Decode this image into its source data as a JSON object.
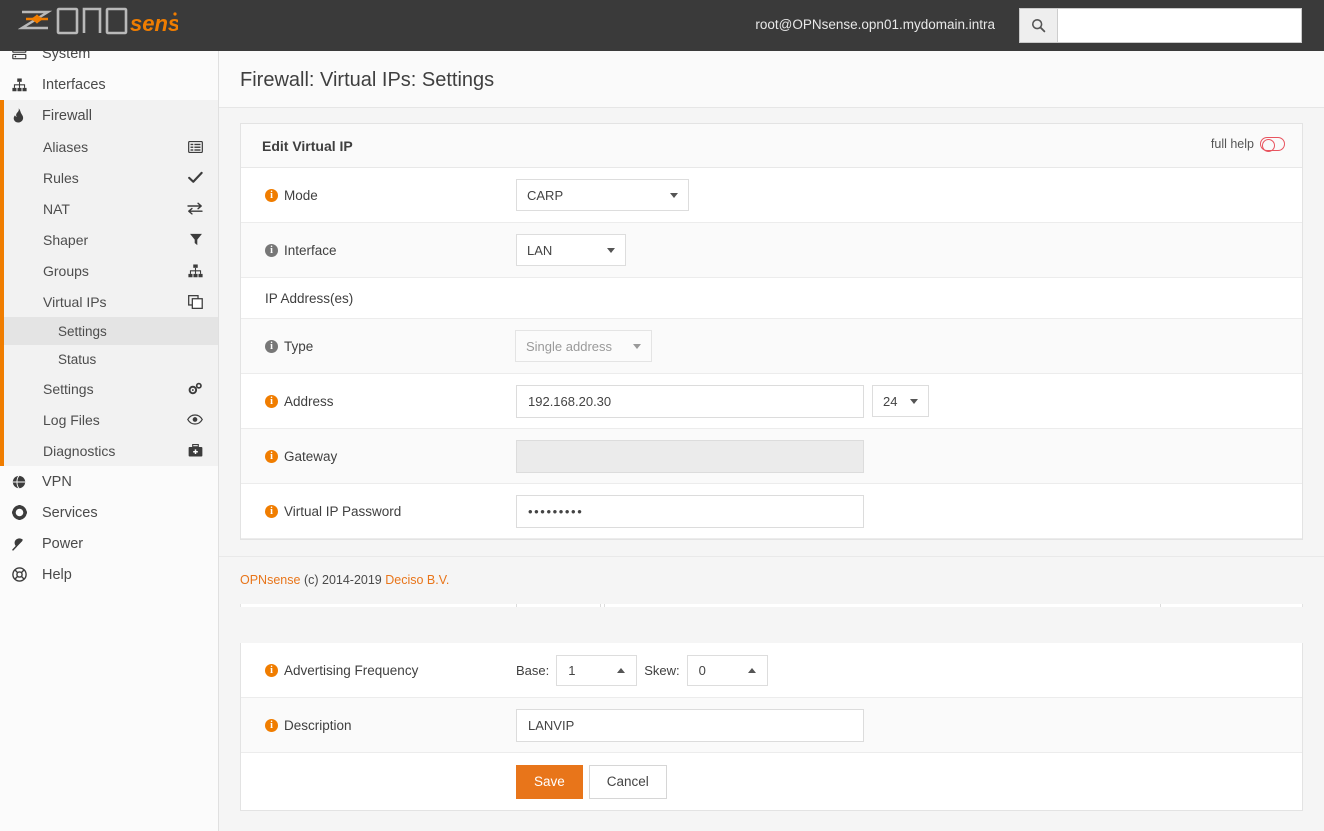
{
  "header": {
    "brand_opn": "OPN",
    "brand_sense": "sense",
    "user": "root@OPNsense.opn01.mydomain.intra",
    "search_placeholder": "",
    "search_value": ""
  },
  "sidebar": {
    "items": [
      {
        "label": "System",
        "icon": "server-icon",
        "level": "top"
      },
      {
        "label": "Interfaces",
        "icon": "sitemap-icon",
        "level": "top"
      },
      {
        "label": "Firewall",
        "icon": "fire-icon",
        "level": "top"
      }
    ],
    "firewall_children": [
      {
        "label": "Aliases",
        "icon": "list-alt-icon"
      },
      {
        "label": "Rules",
        "icon": "check-icon"
      },
      {
        "label": "NAT",
        "icon": "exchange-icon"
      },
      {
        "label": "Shaper",
        "icon": "filter-icon"
      },
      {
        "label": "Groups",
        "icon": "sitemap-icon"
      },
      {
        "label": "Virtual IPs",
        "icon": "clone-icon"
      }
    ],
    "virtualips_children": [
      {
        "label": "Settings",
        "active": true
      },
      {
        "label": "Status",
        "active": false
      }
    ],
    "firewall_tail": [
      {
        "label": "Settings",
        "icon": "gears-icon"
      },
      {
        "label": "Log Files",
        "icon": "eye-icon"
      },
      {
        "label": "Diagnostics",
        "icon": "medkit-icon"
      }
    ],
    "bottom_items": [
      {
        "label": "VPN",
        "icon": "globe-icon"
      },
      {
        "label": "Services",
        "icon": "gear-icon"
      },
      {
        "label": "Power",
        "icon": "plug-icon"
      },
      {
        "label": "Help",
        "icon": "life-ring-icon"
      }
    ]
  },
  "page": {
    "title": "Firewall: Virtual IPs: Settings"
  },
  "panel": {
    "title": "Edit Virtual IP",
    "full_help_label": "full help",
    "full_help_icon": "toggle-off-icon"
  },
  "form": {
    "mode": {
      "label": "Mode",
      "value": "CARP",
      "info": "orange"
    },
    "interface": {
      "label": "Interface",
      "value": "LAN",
      "info": "gray"
    },
    "ip_section": {
      "label": "IP Address(es)"
    },
    "type": {
      "label": "Type",
      "value": "Single address",
      "info": "gray",
      "disabled": true
    },
    "address": {
      "label": "Address",
      "value": "192.168.20.30",
      "cidr": "24",
      "info": "orange"
    },
    "gateway": {
      "label": "Gateway",
      "value": "",
      "info": "orange",
      "disabled": true
    },
    "password": {
      "label": "Virtual IP Password",
      "value": "•••••••••",
      "info": "orange"
    },
    "advertising": {
      "label": "Advertising Frequency",
      "base_label": "Base:",
      "base_value": "1",
      "skew_label": "Skew:",
      "skew_value": "0",
      "info": "orange"
    },
    "description": {
      "label": "Description",
      "value": "LANVIP",
      "info": "orange"
    },
    "buttons": {
      "save": "Save",
      "cancel": "Cancel"
    }
  },
  "footer": {
    "brand": "OPNsense",
    "copyright": "(c) 2014-2019",
    "company": "Deciso B.V."
  },
  "colors": {
    "accent_orange": "#e8751a",
    "logo_orange": "#f07d00",
    "topbar": "#3a3a3a",
    "toggle_red": "#e8545f"
  }
}
